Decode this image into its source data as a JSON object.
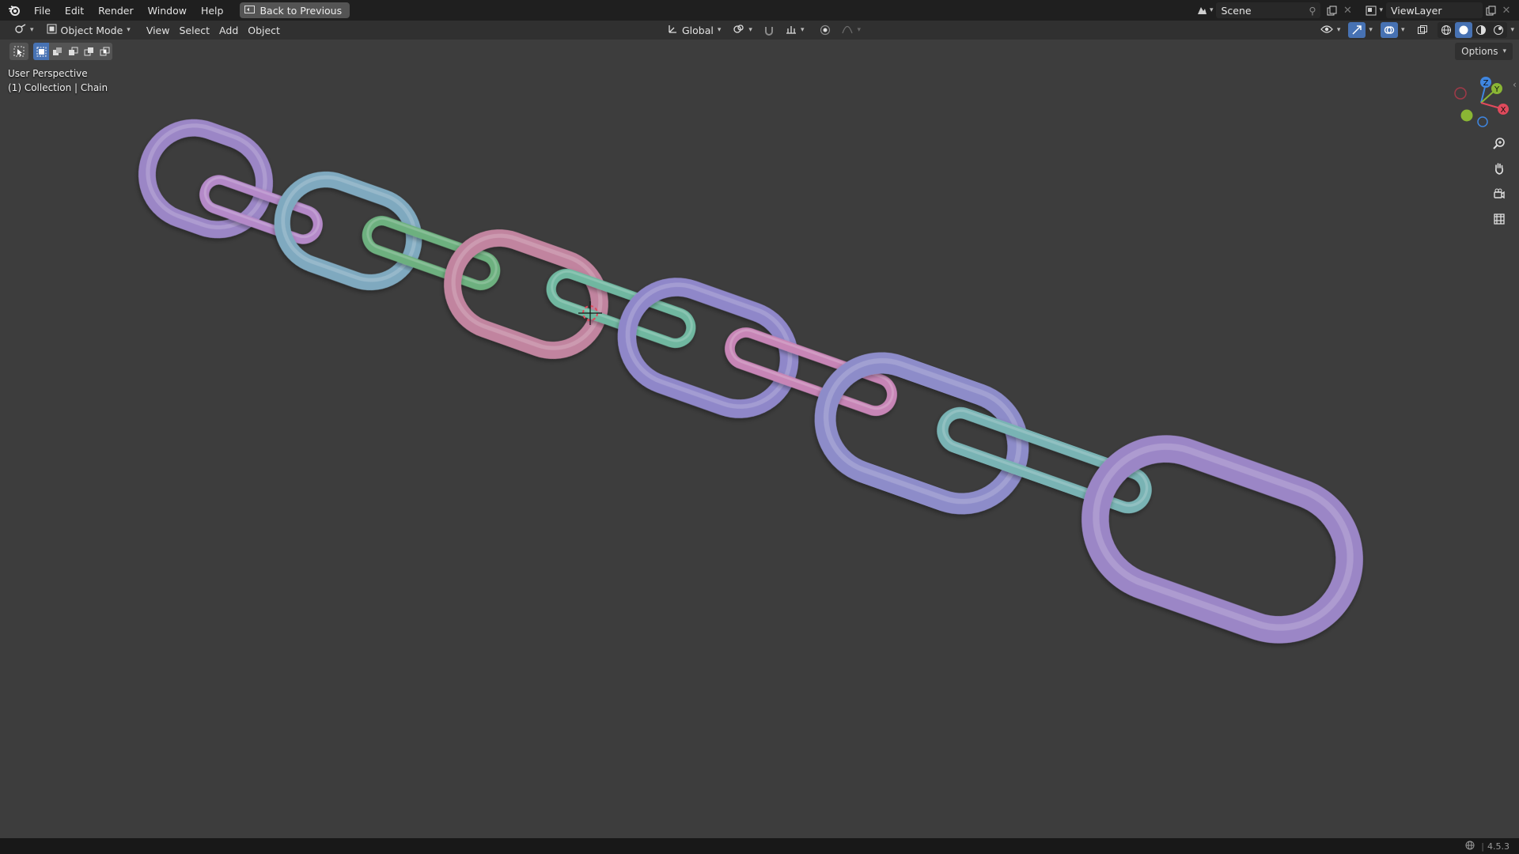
{
  "menu": {
    "items": [
      "File",
      "Edit",
      "Render",
      "Window",
      "Help"
    ],
    "back_button": "Back to Previous"
  },
  "top_right": {
    "scene_name": "Scene",
    "view_layer": "ViewLayer"
  },
  "header": {
    "mode": "Object Mode",
    "menus": [
      "View",
      "Select",
      "Add",
      "Object"
    ],
    "orientation": "Global",
    "options_label": "Options"
  },
  "viewport": {
    "perspective_label": "User Perspective",
    "collection_label": "(1) Collection | Chain",
    "background": "#3d3d3d",
    "gizmo_axes": {
      "x": "X",
      "y": "Y",
      "z": "Z"
    }
  },
  "chain": {
    "object_name": "Chain",
    "link_colors": [
      "#9b86c6",
      "#b489c8",
      "#7fa9bf",
      "#6db07f",
      "#c1849f",
      "#6fb7a0",
      "#8f87c9",
      "#c785b6",
      "#8d8cc9",
      "#79b3b4"
    ]
  },
  "status": {
    "version": "4.5.3"
  },
  "colors": {
    "accent": "#4772b3",
    "axis_x": "#e04a5c",
    "axis_y": "#8ab634",
    "axis_z": "#3f86e0"
  }
}
